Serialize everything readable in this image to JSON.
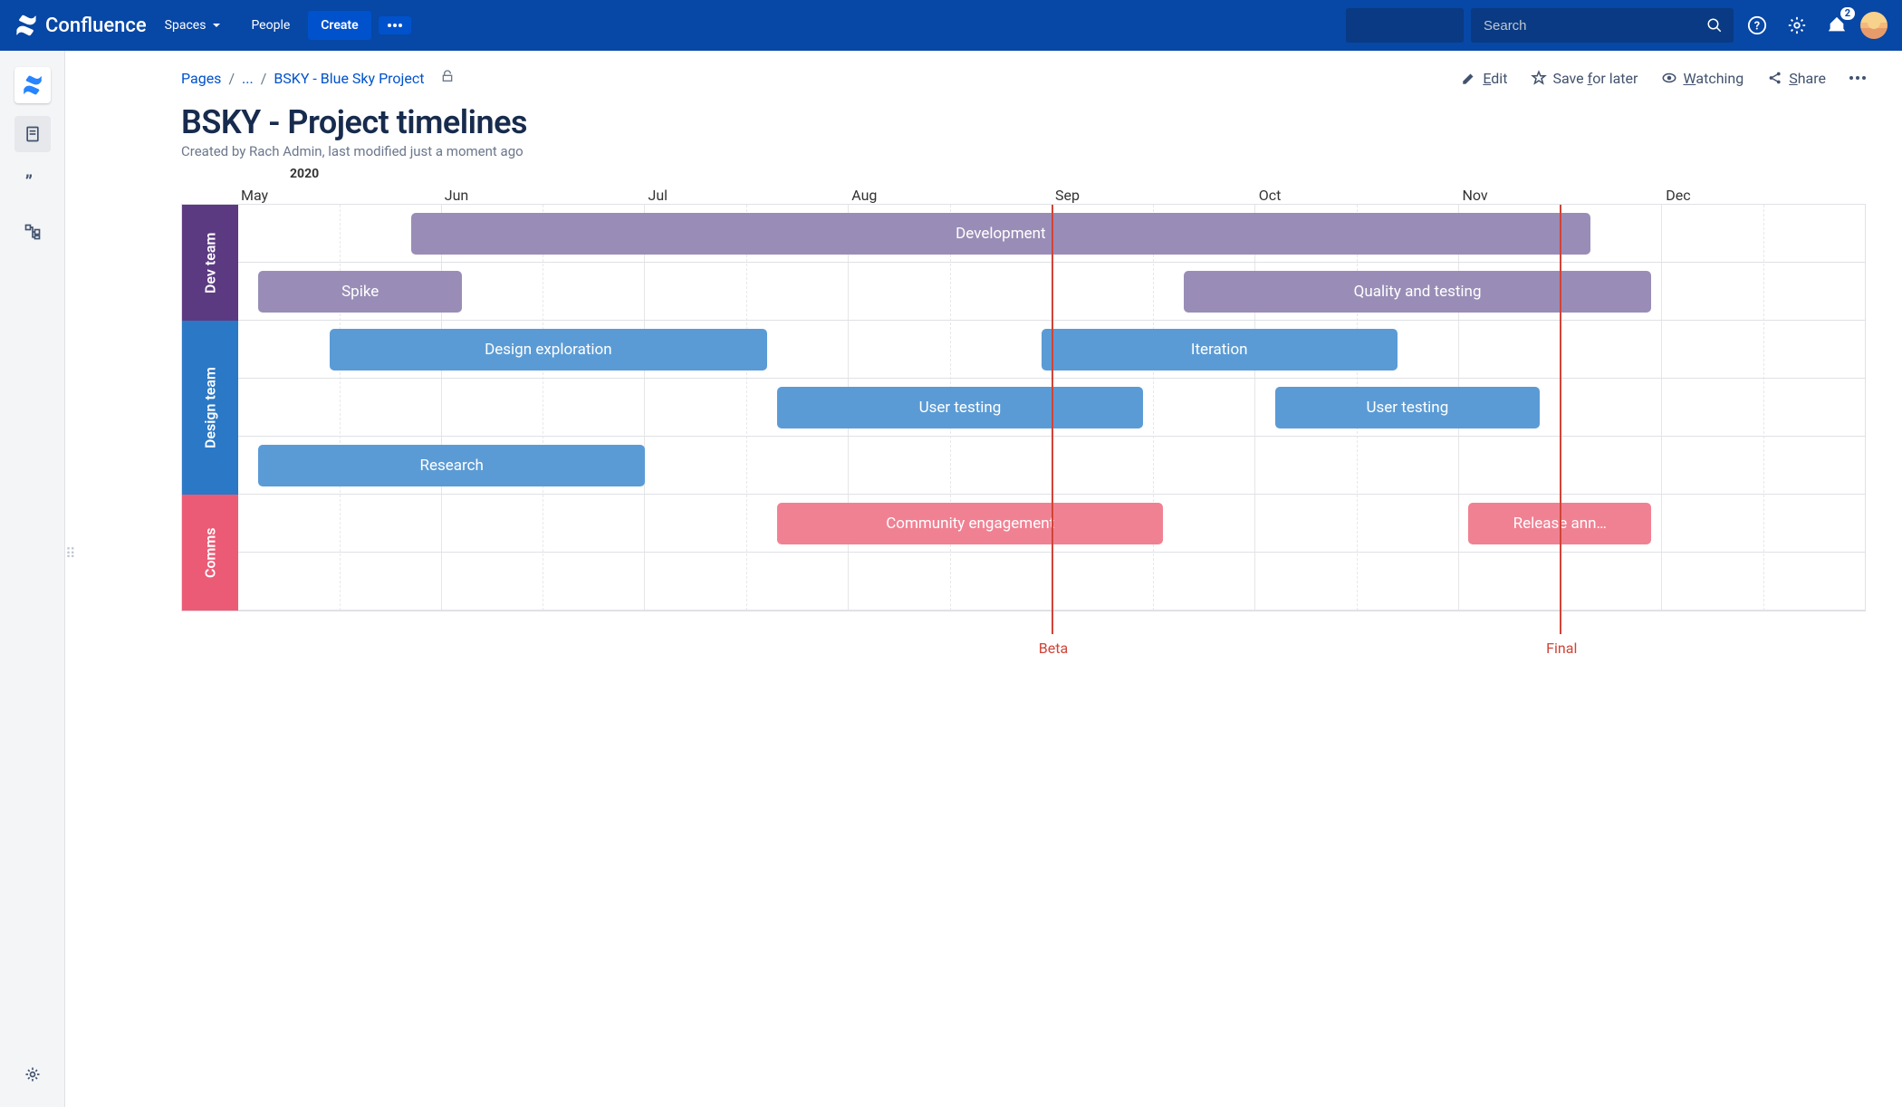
{
  "nav": {
    "product": "Confluence",
    "spaces": "Spaces",
    "people": "People",
    "create": "Create",
    "search_placeholder": "Search",
    "notifications_badge": "2"
  },
  "breadcrumbs": {
    "root": "Pages",
    "ellipsis": "...",
    "parent": "BSKY - Blue Sky Project"
  },
  "actions": {
    "edit": "Edit",
    "save": "Save for later",
    "watching": "Watching",
    "share": "Share"
  },
  "page": {
    "title": "BSKY - Project timelines",
    "byline": "Created by Rach Admin, last modified just a moment ago"
  },
  "roadmap": {
    "year": "2020",
    "months": [
      "May",
      "Jun",
      "Jul",
      "Aug",
      "Sep",
      "Oct",
      "Nov",
      "Dec"
    ],
    "lanes": [
      {
        "id": "dev",
        "label": "Dev team",
        "color": "#5C3A82",
        "rows": 2
      },
      {
        "id": "design",
        "label": "Design team",
        "color": "#2B78C6",
        "rows": 3
      },
      {
        "id": "comms",
        "label": "Comms",
        "color": "#EB5B76",
        "rows": 2
      }
    ],
    "milestones": [
      {
        "label": "Beta",
        "at": 4.0
      },
      {
        "label": "Final",
        "at": 6.5
      }
    ]
  },
  "chart_data": {
    "type": "bar",
    "title": "BSKY - Project timelines",
    "xlabel": "2020",
    "ylabel": "",
    "categories": [
      "May",
      "Jun",
      "Jul",
      "Aug",
      "Sep",
      "Oct",
      "Nov",
      "Dec"
    ],
    "x_range": [
      0,
      8
    ],
    "lanes": [
      "Dev team",
      "Design team",
      "Comms"
    ],
    "series": [
      {
        "lane": "Dev team",
        "row": 0,
        "name": "Development",
        "start": 0.85,
        "end": 6.65,
        "color": "#998DB7"
      },
      {
        "lane": "Dev team",
        "row": 1,
        "name": "Spike",
        "start": 0.1,
        "end": 1.1,
        "color": "#998DB7"
      },
      {
        "lane": "Dev team",
        "row": 1,
        "name": "Quality and testing",
        "start": 4.65,
        "end": 6.95,
        "color": "#998DB7"
      },
      {
        "lane": "Design team",
        "row": 0,
        "name": "Design exploration",
        "start": 0.45,
        "end": 2.6,
        "color": "#5B9BD5"
      },
      {
        "lane": "Design team",
        "row": 0,
        "name": "Iteration",
        "start": 3.95,
        "end": 5.7,
        "color": "#5B9BD5"
      },
      {
        "lane": "Design team",
        "row": 1,
        "name": "User testing",
        "start": 2.65,
        "end": 4.45,
        "color": "#5B9BD5"
      },
      {
        "lane": "Design team",
        "row": 1,
        "name": "User testing",
        "start": 5.1,
        "end": 6.4,
        "color": "#5B9BD5"
      },
      {
        "lane": "Design team",
        "row": 2,
        "name": "Research",
        "start": 0.1,
        "end": 2.0,
        "color": "#5B9BD5"
      },
      {
        "lane": "Comms",
        "row": 0,
        "name": "Community engagement",
        "start": 2.65,
        "end": 4.55,
        "color": "#F08193"
      },
      {
        "lane": "Comms",
        "row": 0,
        "name": "Release ann…",
        "start": 6.05,
        "end": 6.95,
        "color": "#F08193"
      }
    ],
    "milestones": [
      {
        "name": "Beta",
        "x": 4.0
      },
      {
        "name": "Final",
        "x": 6.5
      }
    ]
  }
}
